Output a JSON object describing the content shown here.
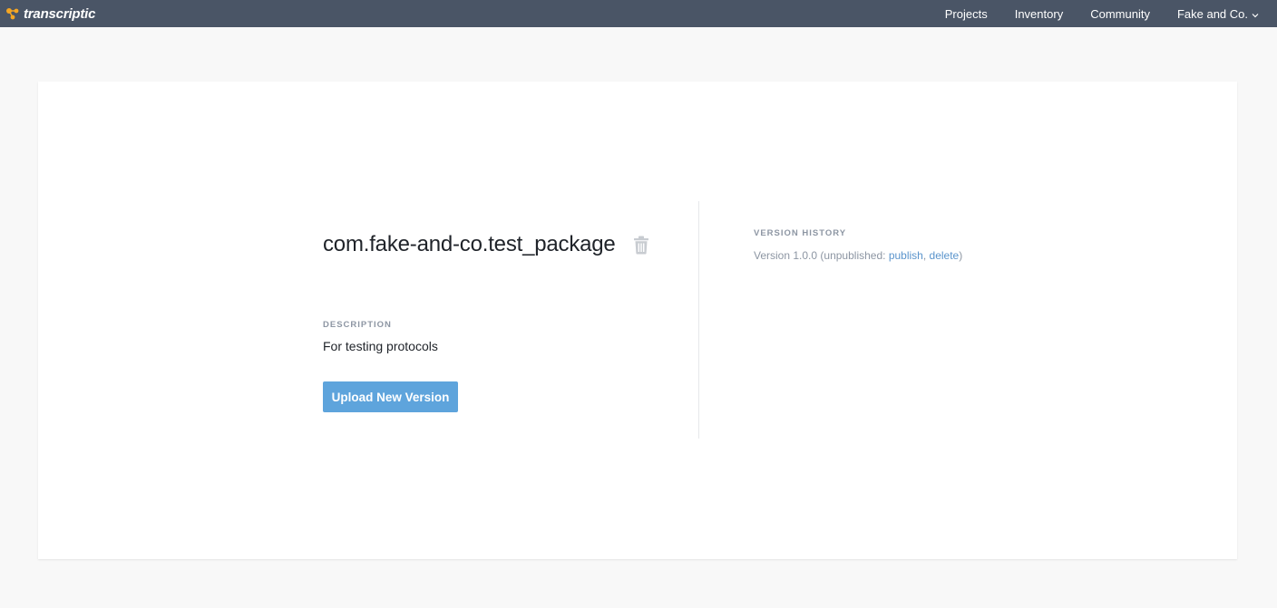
{
  "header": {
    "brand": "transcriptic",
    "nav": [
      {
        "label": "Projects"
      },
      {
        "label": "Inventory"
      },
      {
        "label": "Community"
      }
    ],
    "account_label": "Fake and Co.",
    "bar_color": "#4a5566",
    "logo_color": "#f5a623"
  },
  "package": {
    "title": "com.fake-and-co.test_package",
    "description_label": "DESCRIPTION",
    "description": "For testing protocols",
    "upload_button": "Upload New Version"
  },
  "version_history": {
    "label": "VERSION HISTORY",
    "entries": [
      {
        "version": "Version 1.0.0",
        "status_prefix": "(unpublished:",
        "publish_label": "publish",
        "separator": ",",
        "delete_label": "delete",
        "status_suffix": ")"
      }
    ]
  },
  "icons": {
    "logo": "transcriptic-logo-icon",
    "account_dropdown": "chevron-down-icon",
    "delete_package": "trash-icon"
  },
  "colors": {
    "button": "#5ea4dc",
    "link": "#5a94cc",
    "muted": "#8d96a3"
  }
}
